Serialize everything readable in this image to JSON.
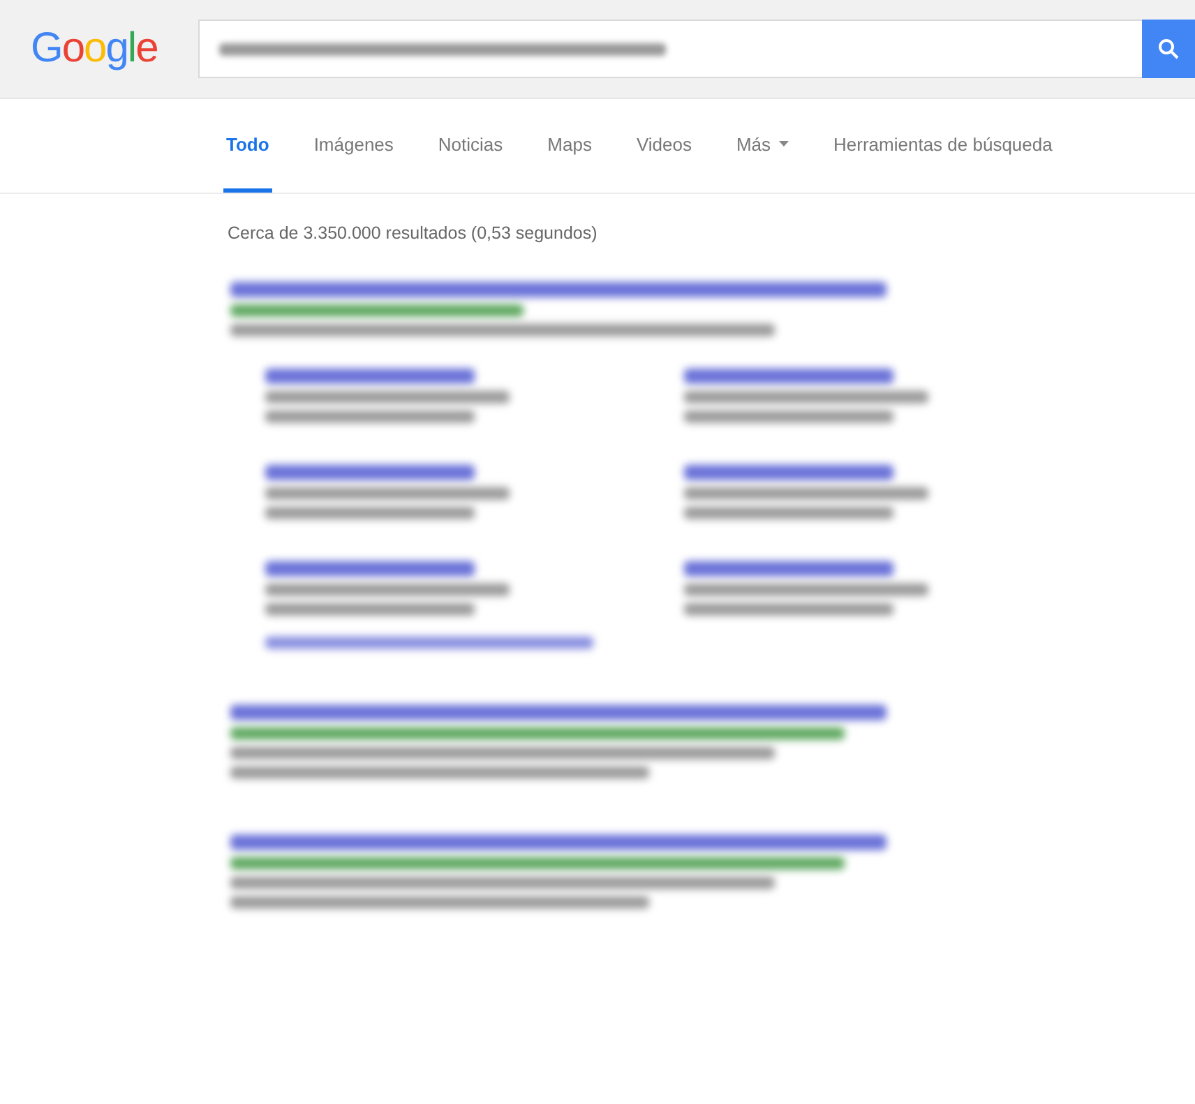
{
  "logo": {
    "letters": [
      {
        "text": "G",
        "color": "#4285f4"
      },
      {
        "text": "o",
        "color": "#ea4335"
      },
      {
        "text": "o",
        "color": "#fbbc05"
      },
      {
        "text": "g",
        "color": "#4285f4"
      },
      {
        "text": "l",
        "color": "#34a853"
      },
      {
        "text": "e",
        "color": "#ea4335"
      }
    ]
  },
  "search": {
    "kind": "blurred"
  },
  "tabs": [
    {
      "label": "Todo",
      "selected": true,
      "kind": "tab"
    },
    {
      "label": "Imágenes",
      "selected": false,
      "kind": "tab"
    },
    {
      "label": "Noticias",
      "selected": false,
      "kind": "tab"
    },
    {
      "label": "Maps",
      "selected": false,
      "kind": "tab"
    },
    {
      "label": "Videos",
      "selected": false,
      "kind": "tab"
    },
    {
      "label": "Más",
      "selected": false,
      "kind": "menu"
    },
    {
      "label": "Herramientas de búsqueda",
      "selected": false,
      "kind": "tab"
    }
  ],
  "stats": "Cerca de 3.350.000 resultados (0,53 segundos)",
  "results": [
    {
      "kind": "sitelinks",
      "snippet_lines": [
        {
          "kind": "line"
        }
      ],
      "sitelinks": [
        {
          "kind": "sitelink"
        },
        {
          "kind": "sitelink"
        },
        {
          "kind": "sitelink"
        },
        {
          "kind": "sitelink"
        },
        {
          "kind": "sitelink"
        },
        {
          "kind": "sitelink"
        }
      ]
    },
    {
      "kind": "plain",
      "snippet_lines": [
        {
          "kind": "line"
        },
        {
          "kind": "line"
        }
      ]
    },
    {
      "kind": "plain",
      "snippet_lines": [
        {
          "kind": "line"
        },
        {
          "kind": "line"
        }
      ]
    }
  ]
}
